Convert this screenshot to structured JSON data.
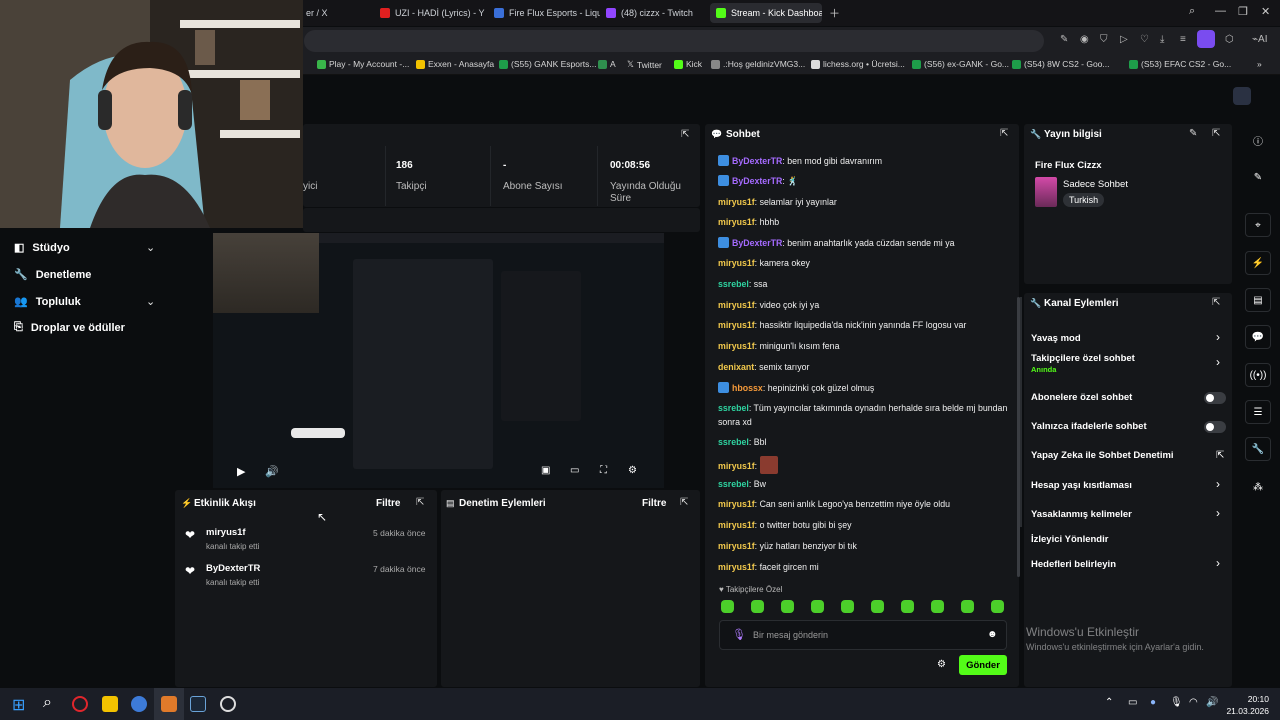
{
  "browser": {
    "tabs": [
      {
        "label": "er / X",
        "color": "#222"
      },
      {
        "label": "UZI - HADİ (Lyrics) - Y",
        "color": "#e02020"
      },
      {
        "label": "Fire Flux Esports - Liquipe",
        "color": "#3a6fd8"
      },
      {
        "label": "(48) cizzx - Twitch",
        "color": "#9146ff"
      },
      {
        "label": "Stream - Kick Dashboard",
        "color": "#53fc18"
      }
    ],
    "bookmarks": [
      {
        "label": "Play - My Account -...",
        "color": "#39b54a"
      },
      {
        "label": "Exxen - Anasayfa",
        "color": "#f2c200"
      },
      {
        "label": "(S55) GANK Esports...",
        "color": "#1e9e4a"
      },
      {
        "label": "A",
        "color": "#2f8f4e"
      },
      {
        "label": "Twitter",
        "color": "#ddd"
      },
      {
        "label": "Kick",
        "color": "#53fc18"
      },
      {
        "label": ".:Hoş geldinizVMG3...",
        "color": "#ddd"
      },
      {
        "label": "lichess.org • Ücretsi...",
        "color": "#ddd"
      },
      {
        "label": "(S56) ex-GANK - Go...",
        "color": "#1e9e4a"
      },
      {
        "label": "(S54) 8W CS2 - Goo...",
        "color": "#1e9e4a"
      },
      {
        "label": "(S53) EFAC CS2 - Go...",
        "color": "#1e9e4a"
      }
    ]
  },
  "stats": {
    "viewers_label": "yici",
    "followers_value": "186",
    "followers_label": "Takipçi",
    "subs_value": "-",
    "subs_label": "Abone Sayısı",
    "uptime_value": "00:08:56",
    "uptime_label": "Yayında Olduğu Süre"
  },
  "sidebar": {
    "items": [
      {
        "label": "Stüdyo",
        "icon": "studio-icon"
      },
      {
        "label": "Denetleme",
        "icon": "wrench-icon"
      },
      {
        "label": "Topluluk",
        "icon": "community-icon"
      },
      {
        "label": "Droplar ve ödüller",
        "icon": "drops-icon"
      }
    ]
  },
  "activity": {
    "title": "Etkinlik Akışı",
    "filter": "Filtre",
    "events": [
      {
        "user": "miryus1f",
        "action": "kanalı takip etti",
        "time": "5 dakika önce"
      },
      {
        "user": "ByDexterTR",
        "action": "kanalı takip etti",
        "time": "7 dakika önce"
      }
    ]
  },
  "moderation": {
    "title": "Denetim Eylemleri",
    "filter": "Filtre"
  },
  "chat": {
    "title": "Sohbet",
    "messages": [
      {
        "user": "ByDexterTR",
        "text": "ben mod gibi davranırım",
        "color": "#a56bff",
        "badge": true
      },
      {
        "user": "ByDexterTR",
        "text": "🕺",
        "color": "#a56bff",
        "badge": true
      },
      {
        "user": "miryus1f",
        "text": "selamlar iyi yayınlar",
        "color": "#f2c94c",
        "badge": false
      },
      {
        "user": "miryus1f",
        "text": "hbhb",
        "color": "#f2c94c",
        "badge": false
      },
      {
        "user": "ByDexterTR",
        "text": "benim anahtarlık yada cüzdan sende mi ya",
        "color": "#a56bff",
        "badge": true
      },
      {
        "user": "miryus1f",
        "text": "kamera okey",
        "color": "#f2c94c",
        "badge": false
      },
      {
        "user": "ssrebel",
        "text": "ssa",
        "color": "#2ed3a0",
        "badge": false
      },
      {
        "user": "miryus1f",
        "text": "video çok iyi ya",
        "color": "#f2c94c",
        "badge": false
      },
      {
        "user": "miryus1f",
        "text": "hassiktir liquipedia'da nick'inin yanında FF logosu var",
        "color": "#f2c94c",
        "badge": false
      },
      {
        "user": "miryus1f",
        "text": "minigun'lı kısım fena",
        "color": "#f2c94c",
        "badge": false
      },
      {
        "user": "denixant",
        "text": "semix tarıyor",
        "color": "#f2c94c",
        "badge": false
      },
      {
        "user": "hbossx",
        "text": "hepinizinki çok güzel olmuş",
        "color": "#f59a3a",
        "badge": true
      },
      {
        "user": "ssrebel",
        "text": "Tüm yayıncılar takımında oynadın herhalde sıra belde mj bundan sonra xd",
        "color": "#2ed3a0",
        "badge": false
      },
      {
        "user": "ssrebel",
        "text": "Bbl",
        "color": "#2ed3a0",
        "badge": false
      },
      {
        "user": "miryus1f",
        "text": "",
        "color": "#f2c94c",
        "badge": false
      },
      {
        "user": "ssrebel",
        "text": "Bw",
        "color": "#2ed3a0",
        "badge": false
      },
      {
        "user": "miryus1f",
        "text": "Can seni anlık Legoo'ya benzettim niye öyle oldu",
        "color": "#f2c94c",
        "badge": false
      },
      {
        "user": "miryus1f",
        "text": "o twitter botu gibi bi şey",
        "color": "#f2c94c",
        "badge": false
      },
      {
        "user": "miryus1f",
        "text": "yüz hatları benziyor bi tık",
        "color": "#f2c94c",
        "badge": false
      },
      {
        "user": "miryus1f",
        "text": "faceit gircen mi",
        "color": "#f2c94c",
        "badge": false
      }
    ],
    "followers_only": "Takipçilere Özel",
    "input_placeholder": "Bir mesaj gönderin",
    "send": "Gönder"
  },
  "stream_info": {
    "title": "Yayın bilgisi",
    "stream_title": "Fire Flux Cizzx",
    "category": "Sadece Sohbet",
    "language": "Turkish"
  },
  "channel_actions": {
    "title": "Kanal Eylemleri",
    "items": [
      {
        "label": "Yavaş mod",
        "control": "chevron"
      },
      {
        "label": "Takipçilere özel sohbet",
        "sub": "Anında",
        "control": "chevron"
      },
      {
        "label": "Abonelere özel sohbet",
        "control": "toggle"
      },
      {
        "label": "Yalnızca ifadelerle sohbet",
        "control": "toggle"
      },
      {
        "label": "Yapay Zeka ile Sohbet Denetimi",
        "control": "external"
      },
      {
        "label": "Hesap yaşı kısıtlaması",
        "control": "chevron"
      },
      {
        "label": "Yasaklanmış kelimeler",
        "control": "chevron"
      },
      {
        "label": "İzleyici Yönlendir",
        "control": "none"
      },
      {
        "label": "Hedefleri belirleyin",
        "control": "chevron"
      }
    ]
  },
  "watermark": {
    "line1": "Windows'u Etkinleştir",
    "line2": "Windows'u etkinleştirmek için Ayarlar'a gidin."
  },
  "taskbar": {
    "time": "20:10",
    "date": "21.03.2026"
  },
  "colors": {
    "accent": "#53fc18",
    "bg": "#0b0d0f",
    "panel": "#15171a"
  }
}
